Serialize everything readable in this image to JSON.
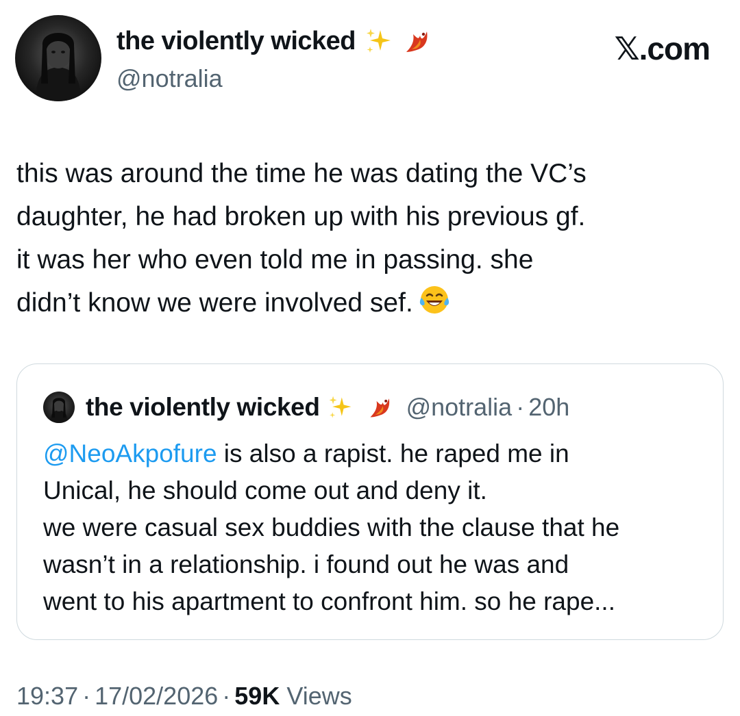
{
  "author": {
    "name": "the violently wicked",
    "handle": "@notralia"
  },
  "brand": "𝕏.com",
  "tweet": {
    "lines": [
      "this was around the time he was dating the VC’s",
      "daughter, he had broken up with his previous gf.",
      "it was her who even told me in passing. she",
      "didn’t know we were involved sef."
    ],
    "emoji": "face-with-tears-of-joy"
  },
  "quote": {
    "name": "the violently wicked",
    "handle": "@notralia",
    "separator": "·",
    "time": "20h",
    "mention": "@NeoAkpofure",
    "line1_rest": " is also a rapist. he raped me in",
    "lines": [
      "Unical, he should come out and deny it.",
      "we were casual sex buddies with the clause that he",
      "wasn’t in a relationship. i found out he was and",
      "went to his apartment to confront him. so he rape..."
    ]
  },
  "meta": {
    "time": "19:37",
    "separator": "·",
    "date": "17/02/2026",
    "views_count": "59K",
    "views_label": " Views"
  },
  "icons": {
    "sparkles": "sparkles-icon",
    "phoenix": "phoenix-icon",
    "emoji": "laughing-emoji-icon"
  },
  "colors": {
    "mention": "#1d9bf0",
    "secondary_text": "#536471",
    "border": "#cfd9de"
  }
}
